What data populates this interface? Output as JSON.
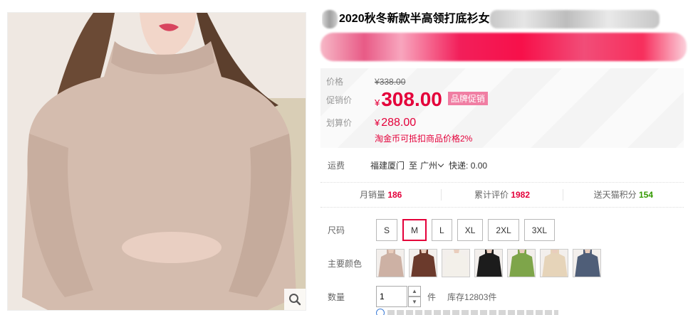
{
  "product": {
    "title": "2020秋冬新款半高领打底衫女"
  },
  "pricing": {
    "original_label": "价格",
    "original_currency": "¥",
    "original_price": "338.00",
    "promo_label": "促销价",
    "promo_currency": "¥",
    "promo_price": "308.00",
    "promo_tag": "品牌促销",
    "calc_label": "划算价",
    "calc_currency": "¥",
    "calc_price": "288.00",
    "coin_note": "淘金币可抵扣商品价格2%"
  },
  "shipping": {
    "label": "运费",
    "from": "福建厦门",
    "to_word": "至",
    "to_city": "广州",
    "express": "快递: 0.00"
  },
  "stats": [
    {
      "label": "月销量",
      "value": "186"
    },
    {
      "label": "累计评价",
      "value": "1982"
    },
    {
      "label": "送天猫积分",
      "value": "154"
    }
  ],
  "size": {
    "label": "尺码",
    "options": [
      "S",
      "M",
      "L",
      "XL",
      "2XL",
      "3XL"
    ],
    "selected": "M"
  },
  "color": {
    "label": "主要颜色",
    "swatches": [
      "#cdb1a4",
      "#6b3a2c",
      "#f3f0ea",
      "#1c1c1c",
      "#7ea54a",
      "#e6d4b9",
      "#4f5e78"
    ]
  },
  "quantity": {
    "label": "数量",
    "value": "1",
    "unit": "件",
    "stock": "库存12803件"
  },
  "icons": {
    "zoom": "magnifier-icon",
    "increase": "chevron-up-icon",
    "decrease": "chevron-down-icon"
  },
  "colors": {
    "accent": "#e4003a",
    "tag": "#f07ea3",
    "points": "#339900"
  }
}
